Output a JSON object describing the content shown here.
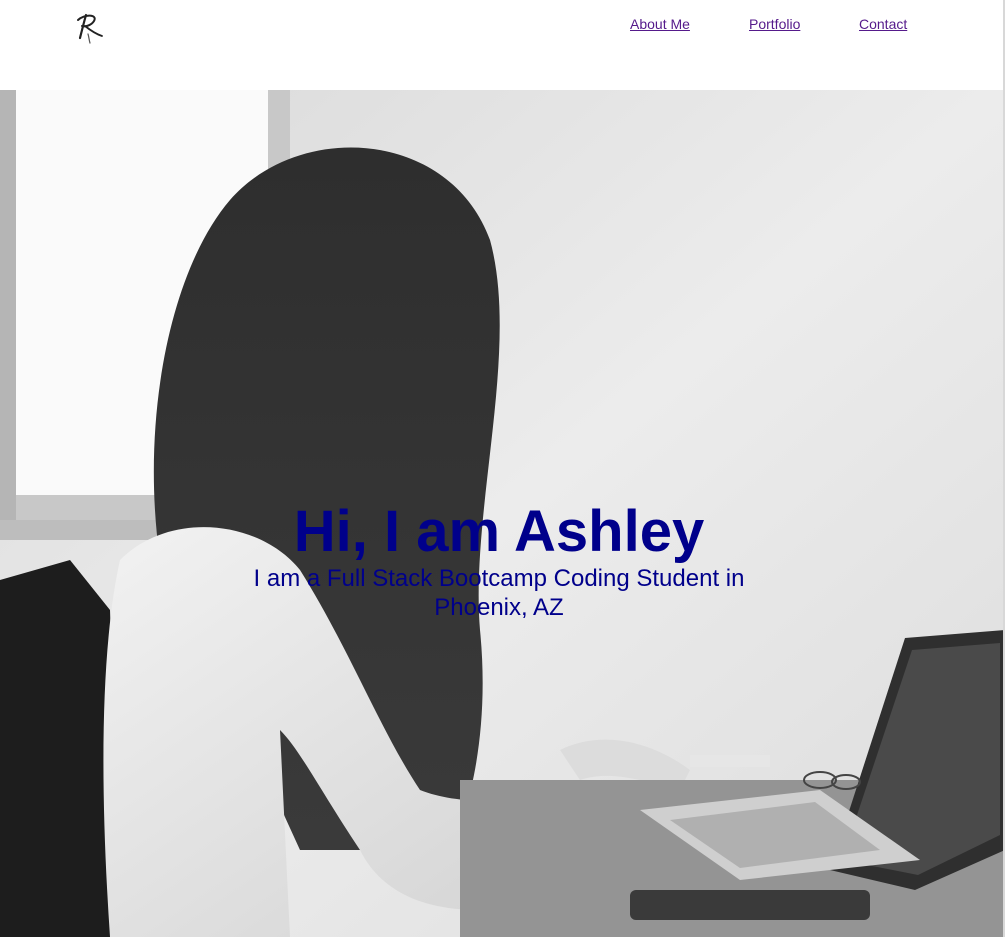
{
  "header": {
    "logo_icon": "signature-r-logo",
    "nav": {
      "about_label": "About Me",
      "portfolio_label": "Portfolio",
      "contact_label": "Contact"
    },
    "link_color": "#551a8b"
  },
  "hero": {
    "title": "Hi, I am Ashley",
    "subtitle": "I am a Full Stack Bootcamp Coding Student in Phoenix, AZ",
    "text_color": "#00008b",
    "image_semantic": "grayscale photo of woman working on laptop"
  }
}
